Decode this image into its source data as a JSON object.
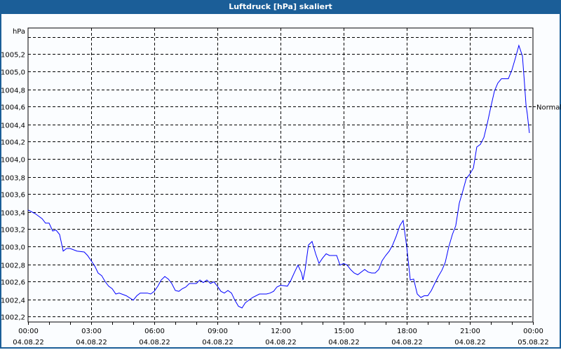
{
  "window_title": "Luftdruck [hPa] skaliert",
  "chart_data": {
    "type": "line",
    "title": "Luftdruck [hPa] skaliert",
    "ylabel": "hPa",
    "xlabel": "",
    "ylim": [
      1002.14,
      1005.5
    ],
    "xlim_hours": [
      0,
      24
    ],
    "grid": true,
    "y_ticks": [
      1002.2,
      1002.4,
      1002.6,
      1002.8,
      1003.0,
      1003.2,
      1003.4,
      1003.6,
      1003.8,
      1004.0,
      1004.2,
      1004.4,
      1004.6,
      1004.8,
      1005.0,
      1005.2,
      1005.4
    ],
    "y_tick_labels": [
      "1002,2",
      "1002,4",
      "1002,6",
      "1002,8",
      "1003,0",
      "1003,2",
      "1003,4",
      "1003,6",
      "1003,8",
      "1004,0",
      "1004,2",
      "1004,4",
      "1004,6",
      "1004,8",
      "1005,0",
      "1005,2",
      ""
    ],
    "x_ticks": [
      {
        "hour": 0,
        "time": "00:00",
        "date": "04.08.22"
      },
      {
        "hour": 3,
        "time": "03:00",
        "date": "04.08.22"
      },
      {
        "hour": 6,
        "time": "06:00",
        "date": "04.08.22"
      },
      {
        "hour": 9,
        "time": "09:00",
        "date": "04.08.22"
      },
      {
        "hour": 12,
        "time": "12:00",
        "date": "04.08.22"
      },
      {
        "hour": 15,
        "time": "15:00",
        "date": "04.08.22"
      },
      {
        "hour": 18,
        "time": "18:00",
        "date": "04.08.22"
      },
      {
        "hour": 21,
        "time": "21:00",
        "date": "04.08.22"
      },
      {
        "hour": 24,
        "time": "00:00",
        "date": "05.08.22"
      }
    ],
    "reference": {
      "label": "Normal",
      "value": 1004.6
    },
    "series": [
      {
        "name": "Luftdruck",
        "color": "#0000ff",
        "x": [
          0,
          0.33,
          0.67,
          0.83,
          1.0,
          1.17,
          1.33,
          1.5,
          1.67,
          1.83,
          2.0,
          2.33,
          2.67,
          2.83,
          3.0,
          3.17,
          3.33,
          3.5,
          3.67,
          3.83,
          4.0,
          4.17,
          4.33,
          4.67,
          5.0,
          5.17,
          5.33,
          5.67,
          5.83,
          6.0,
          6.17,
          6.33,
          6.5,
          6.67,
          6.83,
          7.0,
          7.17,
          7.33,
          7.5,
          7.67,
          8.0,
          8.17,
          8.33,
          8.5,
          8.67,
          8.83,
          9.0,
          9.17,
          9.33,
          9.5,
          9.67,
          9.83,
          10.0,
          10.17,
          10.33,
          10.67,
          11.0,
          11.33,
          11.5,
          11.67,
          11.83,
          12.0,
          12.33,
          12.5,
          12.67,
          12.83,
          13.0,
          13.07,
          13.17,
          13.33,
          13.5,
          13.67,
          13.83,
          14.0,
          14.17,
          14.33,
          14.67,
          14.83,
          15.0,
          15.17,
          15.33,
          15.5,
          15.67,
          16.0,
          16.17,
          16.33,
          16.5,
          16.67,
          16.83,
          17.0,
          17.17,
          17.33,
          17.5,
          17.67,
          17.83,
          18.0,
          18.17,
          18.33,
          18.5,
          18.67,
          18.83,
          19.0,
          19.17,
          19.33,
          19.5,
          19.67,
          19.83,
          20.0,
          20.17,
          20.33,
          20.5,
          20.67,
          20.83,
          21.0,
          21.17,
          21.33,
          21.5,
          21.67,
          21.83,
          22.0,
          22.17,
          22.33,
          22.5,
          22.67,
          22.83,
          23.0,
          23.17,
          23.33,
          23.5,
          23.6,
          23.67,
          23.73,
          23.83
        ],
        "values": [
          1003.42,
          1003.38,
          1003.32,
          1003.27,
          1003.27,
          1003.18,
          1003.19,
          1003.14,
          1002.95,
          1002.98,
          1002.98,
          1002.95,
          1002.94,
          1002.9,
          1002.84,
          1002.78,
          1002.7,
          1002.67,
          1002.6,
          1002.55,
          1002.52,
          1002.46,
          1002.47,
          1002.44,
          1002.39,
          1002.44,
          1002.47,
          1002.47,
          1002.46,
          1002.49,
          1002.55,
          1002.62,
          1002.66,
          1002.63,
          1002.58,
          1002.5,
          1002.49,
          1002.52,
          1002.54,
          1002.58,
          1002.58,
          1002.62,
          1002.59,
          1002.62,
          1002.58,
          1002.6,
          1002.55,
          1002.49,
          1002.47,
          1002.5,
          1002.47,
          1002.39,
          1002.32,
          1002.3,
          1002.36,
          1002.42,
          1002.46,
          1002.46,
          1002.47,
          1002.49,
          1002.54,
          1002.56,
          1002.55,
          1002.62,
          1002.71,
          1002.79,
          1002.7,
          1002.62,
          1002.74,
          1003.02,
          1003.06,
          1002.92,
          1002.81,
          1002.87,
          1002.92,
          1002.9,
          1002.9,
          1002.79,
          1002.81,
          1002.79,
          1002.74,
          1002.7,
          1002.68,
          1002.74,
          1002.71,
          1002.7,
          1002.7,
          1002.74,
          1002.84,
          1002.9,
          1002.95,
          1003.02,
          1003.12,
          1003.24,
          1003.3,
          1003.0,
          1002.62,
          1002.63,
          1002.46,
          1002.42,
          1002.44,
          1002.44,
          1002.5,
          1002.58,
          1002.66,
          1002.73,
          1002.82,
          1003.0,
          1003.14,
          1003.24,
          1003.5,
          1003.64,
          1003.78,
          1003.83,
          1003.9,
          1004.14,
          1004.17,
          1004.25,
          1004.41,
          1004.6,
          1004.78,
          1004.87,
          1004.92,
          1004.92,
          1004.92,
          1005.02,
          1005.16,
          1005.3,
          1005.18,
          1004.86,
          1004.62,
          1004.52,
          1004.3
        ]
      }
    ]
  }
}
